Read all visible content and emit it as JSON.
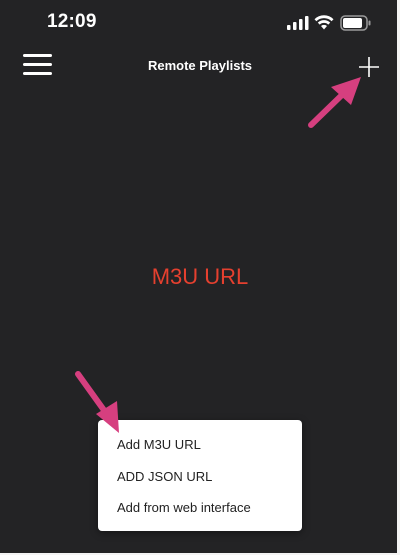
{
  "status_bar": {
    "time": "12:09",
    "icons": [
      "signal-icon",
      "wifi-icon",
      "battery-icon"
    ]
  },
  "nav": {
    "title": "Remote Playlists",
    "menu_icon": "hamburger-menu-icon",
    "add_icon": "plus-icon"
  },
  "main": {
    "label": "M3U URL"
  },
  "popup_menu": {
    "items": [
      {
        "label": "Add M3U URL"
      },
      {
        "label": "ADD JSON URL"
      },
      {
        "label": "Add from web interface"
      }
    ]
  },
  "colors": {
    "background": "#232325",
    "label": "#e5402f",
    "annotation_arrow": "#d63f7f",
    "popup_bg": "#ffffff"
  }
}
